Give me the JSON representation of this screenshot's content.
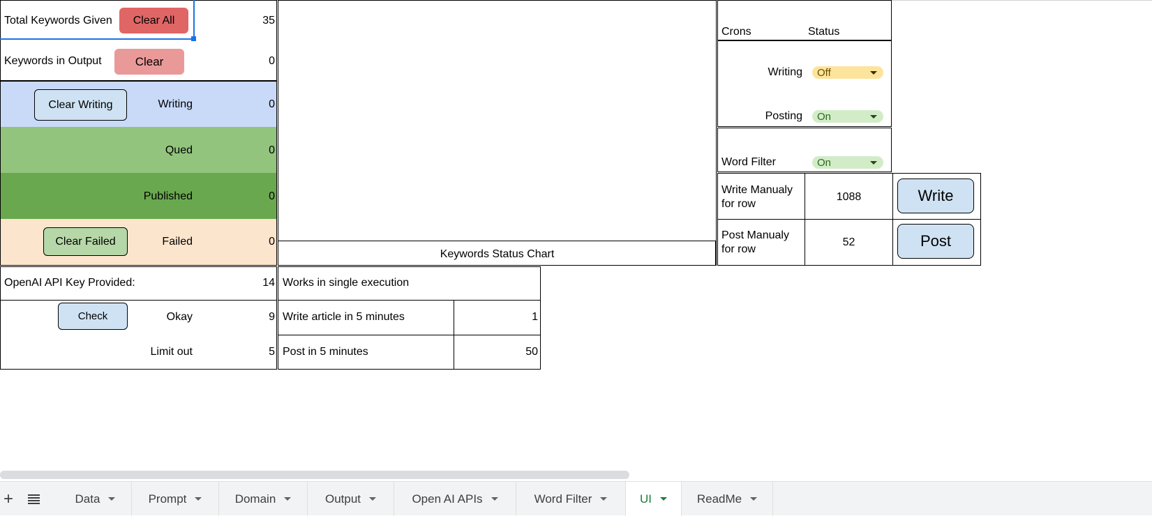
{
  "left_panel": {
    "total_keywords_label": "Total Keywords Given",
    "clear_all_label": "Clear All",
    "total_keywords_value": "35",
    "keywords_output_label": "Keywords in Output",
    "clear_label": "Clear",
    "keywords_output_value": "0",
    "clear_writing_label": "Clear Writing",
    "writing_label": "Writing",
    "writing_value": "0",
    "qued_label": "Qued",
    "qued_value": "0",
    "published_label": "Published",
    "published_value": "0",
    "clear_failed_label": "Clear Failed",
    "failed_label": "Failed",
    "failed_value": "0"
  },
  "api_panel": {
    "key_label": "OpenAI API Key Provided:",
    "key_value": "14",
    "check_label": "Check",
    "okay_label": "Okay",
    "okay_value": "9",
    "limit_label": "Limit out",
    "limit_value": "5"
  },
  "chart": {
    "caption": "Keywords Status Chart"
  },
  "execution_panel": {
    "header": "Works in single execution",
    "write_label": "Write article in 5 minutes",
    "write_value": "1",
    "post_label": "Post in 5 minutes",
    "post_value": "50"
  },
  "crons": {
    "crons_header": "Crons",
    "status_header": "Status",
    "writing_label": "Writing",
    "writing_status": "Off",
    "posting_label": "Posting",
    "posting_status": "On",
    "word_filter_label": "Word Filter",
    "word_filter_status": "On"
  },
  "manual": {
    "write_label": "Write Manualy for row",
    "write_value": "1088",
    "write_button": "Write",
    "post_label": "Post Manualy for row",
    "post_value": "52",
    "post_button": "Post"
  },
  "colors": {
    "writing_bg": "#c9daf8",
    "qued_bg": "#93c47d",
    "published_bg": "#6aa84f",
    "failed_bg": "#fce5cd",
    "active_tab": "#188038"
  },
  "tabs": {
    "add_icon": "+",
    "sheets_menu_icon": "list-icon",
    "items": [
      {
        "label": "Data"
      },
      {
        "label": "Prompt"
      },
      {
        "label": "Domain"
      },
      {
        "label": "Output"
      },
      {
        "label": "Open AI APIs"
      },
      {
        "label": "Word Filter"
      },
      {
        "label": "UI"
      },
      {
        "label": "ReadMe"
      }
    ]
  }
}
